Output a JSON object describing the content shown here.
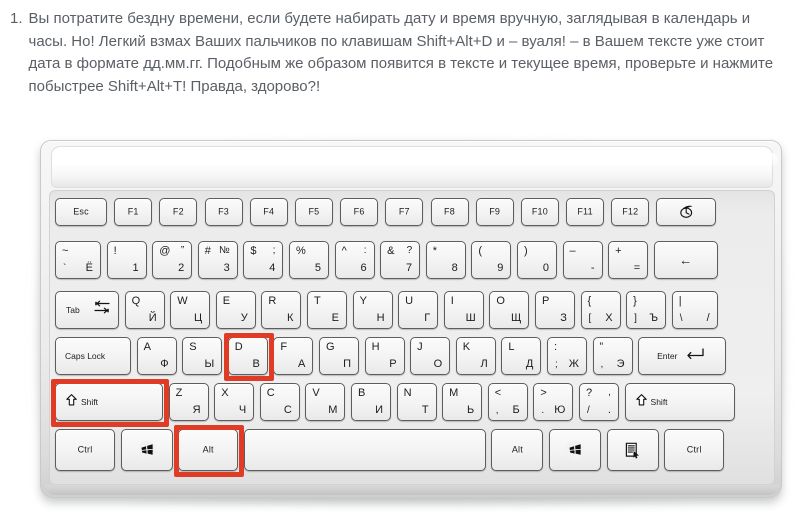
{
  "intro": {
    "marker": "1.",
    "text": "Вы потратите бездну времени, если будете набирать дату и время вручную, заглядывая в календарь и часы. Но! Легкий взмах Ваших пальчиков по клавишам Shift+Alt+D и – вуаля! – в Вашем тексте уже стоит дата в формате дд.мм.гг. Подобным же образом появится в тексте и текущее время, проверьте и нажмите побыстрее Shift+Alt+T! Правда, здорово?!",
    "text_color": "#5b6066"
  },
  "highlight": {
    "color": "#e03b24",
    "keys": [
      "shift-left",
      "alt-left",
      "d"
    ]
  },
  "keyboard": {
    "layout_name": "US / Russian dual-legend",
    "rows": {
      "function_row": [
        {
          "name": "esc",
          "label": "Esc"
        },
        {
          "name": "f1",
          "label": "F1"
        },
        {
          "name": "f2",
          "label": "F2"
        },
        {
          "name": "f3",
          "label": "F3"
        },
        {
          "name": "f4",
          "label": "F4"
        },
        {
          "name": "f5",
          "label": "F5"
        },
        {
          "name": "f6",
          "label": "F6"
        },
        {
          "name": "f7",
          "label": "F7"
        },
        {
          "name": "f8",
          "label": "F8"
        },
        {
          "name": "f9",
          "label": "F9"
        },
        {
          "name": "f10",
          "label": "F10"
        },
        {
          "name": "f11",
          "label": "F11"
        },
        {
          "name": "f12",
          "label": "F12"
        },
        {
          "name": "power-sleep",
          "label": "",
          "icon": "power-sleep-icon"
        }
      ],
      "number_row": [
        {
          "name": "tilde",
          "tl": "~",
          "bl": "`",
          "br": "Ё"
        },
        {
          "name": "digit-1",
          "tl": "!",
          "br": "1"
        },
        {
          "name": "digit-2",
          "tl": "@",
          "tr": "”",
          "br": "2"
        },
        {
          "name": "digit-3",
          "tl": "#",
          "tr": "№",
          "br": "3"
        },
        {
          "name": "digit-4",
          "tl": "$",
          "tr": ";",
          "br": "4"
        },
        {
          "name": "digit-5",
          "tl": "%",
          "br": "5"
        },
        {
          "name": "digit-6",
          "tl": "^",
          "tr": ":",
          "br": "6"
        },
        {
          "name": "digit-7",
          "tl": "&",
          "tr": "?",
          "br": "7"
        },
        {
          "name": "digit-8",
          "tl": "*",
          "br": "8"
        },
        {
          "name": "digit-9",
          "tl": "(",
          "br": "9"
        },
        {
          "name": "digit-0",
          "tl": ")",
          "br": "0"
        },
        {
          "name": "minus",
          "tl": "–",
          "br": "-"
        },
        {
          "name": "equal",
          "tl": "+",
          "br": "="
        },
        {
          "name": "backspace",
          "glyph": "←"
        }
      ],
      "top_row": [
        {
          "name": "tab",
          "label": "Tab",
          "icon": "tab-arrows-icon"
        },
        {
          "name": "q",
          "tl": "Q",
          "br": "Й"
        },
        {
          "name": "w",
          "tl": "W",
          "br": "Ц"
        },
        {
          "name": "e",
          "tl": "E",
          "br": "У"
        },
        {
          "name": "r",
          "tl": "R",
          "br": "К"
        },
        {
          "name": "t",
          "tl": "T",
          "br": "Е"
        },
        {
          "name": "y",
          "tl": "Y",
          "br": "Н"
        },
        {
          "name": "u",
          "tl": "U",
          "br": "Г"
        },
        {
          "name": "i",
          "tl": "I",
          "br": "Ш"
        },
        {
          "name": "o",
          "tl": "O",
          "br": "Щ"
        },
        {
          "name": "p",
          "tl": "P",
          "br": "З"
        },
        {
          "name": "bracket-left",
          "tl": "{",
          "bl": "[",
          "br": "Х"
        },
        {
          "name": "bracket-right",
          "tl": "}",
          "bl": "]",
          "br": "Ъ"
        },
        {
          "name": "backslash",
          "tl": "|",
          "bl": "\\",
          "br": "/"
        }
      ],
      "home_row": [
        {
          "name": "caps-lock",
          "label": "Caps Lock"
        },
        {
          "name": "a",
          "tl": "A",
          "br": "Ф"
        },
        {
          "name": "s",
          "tl": "S",
          "br": "Ы"
        },
        {
          "name": "d",
          "tl": "D",
          "br": "В"
        },
        {
          "name": "f",
          "tl": "F",
          "br": "А"
        },
        {
          "name": "g",
          "tl": "G",
          "br": "П"
        },
        {
          "name": "h",
          "tl": "H",
          "br": "Р"
        },
        {
          "name": "j",
          "tl": "J",
          "br": "О"
        },
        {
          "name": "k",
          "tl": "K",
          "br": "Л"
        },
        {
          "name": "l",
          "tl": "L",
          "br": "Д"
        },
        {
          "name": "semicolon",
          "tl": ":",
          "bl": ";",
          "br": "Ж"
        },
        {
          "name": "quote",
          "tl": "”",
          "bl": ",",
          "br": "Э"
        },
        {
          "name": "enter",
          "label": "Enter",
          "icon": "enter-arrow-icon"
        }
      ],
      "bottom_row": [
        {
          "name": "shift-left",
          "label": "Shift",
          "icon": "shift-arrow-icon"
        },
        {
          "name": "z",
          "tl": "Z",
          "br": "Я"
        },
        {
          "name": "x",
          "tl": "X",
          "br": "Ч"
        },
        {
          "name": "c",
          "tl": "C",
          "br": "С"
        },
        {
          "name": "v",
          "tl": "V",
          "br": "М"
        },
        {
          "name": "b",
          "tl": "B",
          "br": "И"
        },
        {
          "name": "n",
          "tl": "N",
          "br": "Т"
        },
        {
          "name": "m",
          "tl": "M",
          "br": "Ь"
        },
        {
          "name": "comma",
          "tl": "<",
          "bl": ",",
          "br": "Б"
        },
        {
          "name": "period",
          "tl": ">",
          "bl": ".",
          "br": "Ю"
        },
        {
          "name": "slash",
          "tl": "?",
          "tr": ",",
          "bl": "/",
          "br": "."
        },
        {
          "name": "shift-right",
          "label": "Shift",
          "icon": "shift-arrow-icon"
        }
      ],
      "modifier_row": [
        {
          "name": "ctrl-left",
          "label": "Ctrl"
        },
        {
          "name": "win-left",
          "label": "",
          "icon": "windows-icon"
        },
        {
          "name": "alt-left",
          "label": "Alt"
        },
        {
          "name": "space",
          "label": ""
        },
        {
          "name": "alt-right",
          "label": "Alt"
        },
        {
          "name": "win-right",
          "label": "",
          "icon": "windows-icon"
        },
        {
          "name": "menu",
          "label": "",
          "icon": "context-menu-icon"
        },
        {
          "name": "ctrl-right",
          "label": "Ctrl"
        }
      ]
    }
  }
}
